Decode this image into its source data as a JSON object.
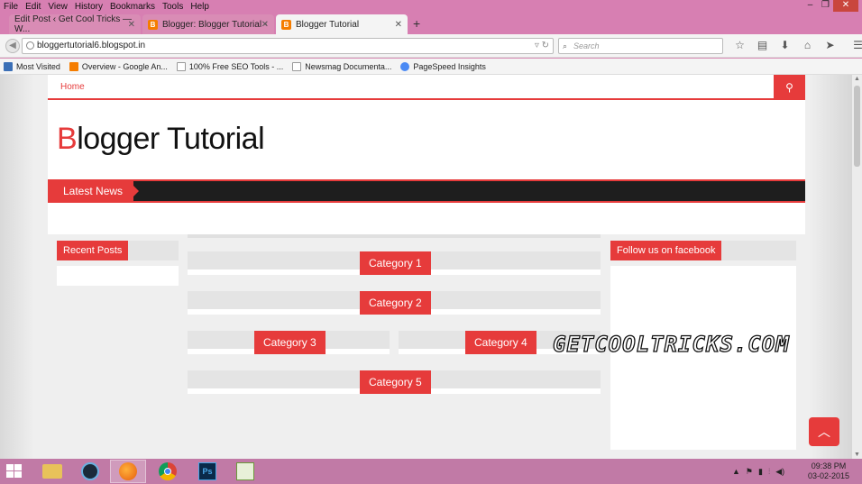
{
  "browser": {
    "menu": [
      "File",
      "Edit",
      "View",
      "History",
      "Bookmarks",
      "Tools",
      "Help"
    ],
    "tabs": [
      {
        "title": "Edit Post ‹ Get Cool Tricks — W..."
      },
      {
        "title": "Blogger: Blogger Tutorial -"
      },
      {
        "title": "Blogger Tutorial"
      }
    ],
    "url": "bloggertutorial6.blogspot.in",
    "search_placeholder": "Search",
    "bookmarks": [
      {
        "label": "Most Visited",
        "color": "#3b6fb6"
      },
      {
        "label": "Overview - Google An...",
        "color": "#f57d00"
      },
      {
        "label": "100% Free SEO Tools - ...",
        "color": "#ffffff"
      },
      {
        "label": "Newsmag Documenta...",
        "color": "#ffffff"
      },
      {
        "label": "PageSpeed Insights",
        "color": "#4a8af4"
      }
    ]
  },
  "site": {
    "accent": "#e63b3b",
    "nav_home": "Home",
    "title_first": "B",
    "title_rest": "logger Tutorial",
    "latest_news": "Latest News",
    "recent_posts": "Recent Posts",
    "follow_facebook": "Follow us on facebook",
    "categories": [
      "Category 1",
      "Category 2",
      "Category 3",
      "Category 4",
      "Category 5"
    ],
    "watermark": "GETCOOLTRICKS.COM"
  },
  "taskbar": {
    "time": "09:38 PM",
    "date": "03-02-2015"
  }
}
